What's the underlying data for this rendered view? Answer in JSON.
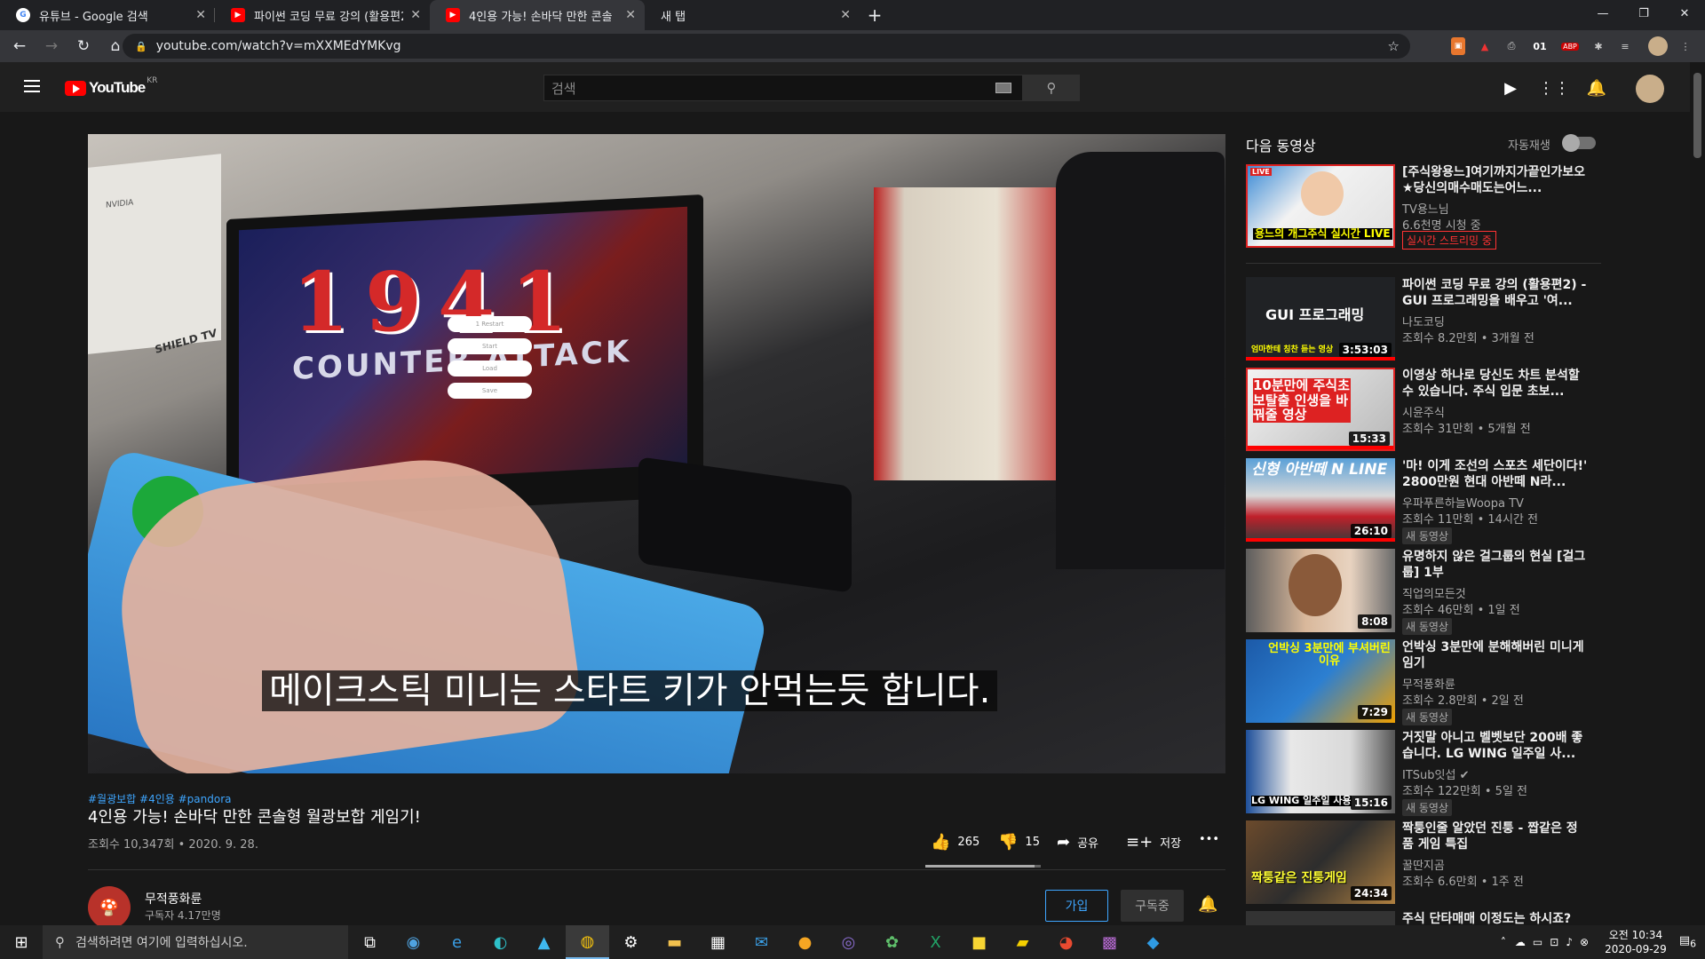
{
  "browser": {
    "tabs": [
      {
        "title": "유튜브 - Google 검색",
        "favicon": "google-icon",
        "active": false
      },
      {
        "title": "파이썬 코딩 무료 강의 (활용편2) -",
        "favicon": "youtube-icon",
        "active": false
      },
      {
        "title": "4인용 가능! 손바닥 만한 콘솔",
        "favicon": "youtube-icon",
        "active": true
      },
      {
        "title": "새 탭",
        "favicon": "",
        "active": false
      }
    ],
    "url": "youtube.com/watch?v=mXXMEdYMKvg",
    "extensions": [
      "ext-orange-icon",
      "pdf-icon",
      "printer-icon",
      "01",
      "adblock-icon",
      "puzzle-icon",
      "playlist-icon",
      "profile-icon"
    ],
    "adblock_count": "25"
  },
  "youtube": {
    "logo_text": "YouTube",
    "region": "KR",
    "search_placeholder": "검색"
  },
  "video": {
    "game_title": "1941",
    "subtitle_line": "COUNTER ATTACK",
    "menu_items": [
      "1 Restart",
      "Start",
      "Load",
      "Save"
    ],
    "caption": "메이크스틱 미니는 스타트 키가 안먹는듯 합니다.",
    "box_label": "SHIELD TV",
    "box_brand": "NVIDIA",
    "tags": "#월광보합 #4인용 #pandora",
    "title": "4인용 가능! 손바닥 만한 콘솔형 월광보합 게임기!",
    "views": "조회수 10,347회 • 2020. 9. 28.",
    "likes": "265",
    "dislikes": "15",
    "like_ratio": 0.946,
    "share": "공유",
    "save": "저장",
    "more": "•••"
  },
  "channel": {
    "name": "무적풍화륜",
    "subscribers": "구독자 4.17만명",
    "join": "가입",
    "subscribed": "구독중"
  },
  "sidebar": {
    "up_next": "다음 동영상",
    "autoplay": "자동재생",
    "live": {
      "title": "[주식왕용느]여기까지가끝인가보오★당신의매수매도는어느...",
      "channel": "TV용느님",
      "stat": "6.6천명 시청 중",
      "badge": "실시간 스트리밍 중",
      "thumb_text": "용느의 개그주식 실시간 LIVE",
      "thumb_tag": "LIVE"
    },
    "items": [
      {
        "title": "파이썬 코딩 무료 강의 (활용편2) - GUI 프로그래밍을 배우고 '여...",
        "channel": "나도코딩",
        "stat": "조회수 8.2만회 • 3개월 전",
        "duration": "3:53:03",
        "thumb_text": "GUI 프로그래밍",
        "thumb_sub": "엄마한테 칭찬 듣는 영상",
        "badge": "",
        "progress": 1.0
      },
      {
        "title": "이영상 하나로 당신도 차트 분석할 수 있습니다. 주식 입문 초보...",
        "channel": "시윤주식",
        "stat": "조회수 31만회 • 5개월 전",
        "duration": "15:33",
        "thumb_text": "10분만에 주식초보탈출 인생을 바꿔줄 영상",
        "thumb_sub": "",
        "badge": "",
        "progress": 1.0
      },
      {
        "title": "'마! 이게 조선의 스포츠 세단이다!' 2800만원 현대 아반떼 N라...",
        "channel": "우파푸른하늘Woopa TV",
        "stat": "조회수 11만회 • 14시간 전",
        "duration": "26:10",
        "thumb_text": "신형 아반떼 N LINE",
        "thumb_sub": "",
        "badge": "새 동영상",
        "progress": 1.0
      },
      {
        "title": "유명하지 않은 걸그룹의 현실 [걸그룹] 1부",
        "channel": "직업의모든것",
        "stat": "조회수 46만회 • 1일 전",
        "duration": "8:08",
        "thumb_text": "",
        "thumb_sub": "",
        "badge": "새 동영상",
        "progress": 0
      },
      {
        "title": "언박싱 3분만에 분해해버린 미니게임기",
        "channel": "무적풍화륜",
        "stat": "조회수 2.8만회 • 2일 전",
        "duration": "7:29",
        "thumb_text": "언박싱 3분만에 부셔버린 이유",
        "thumb_sub": "",
        "badge": "새 동영상",
        "progress": 0
      },
      {
        "title": "거짓말 아니고 벨벳보단 200배 좋습니다. LG WING 일주일 사...",
        "channel": "ITSub잇섭",
        "stat": "조회수 122만회 • 5일 전",
        "duration": "15:16",
        "thumb_text": "LG WING 일주일 사용",
        "thumb_sub": "",
        "badge": "새 동영상",
        "progress": 0
      },
      {
        "title": "짝퉁인줄 알았던 진퉁 - 짭같은 정품 게임 특집",
        "channel": "꿀딴지곰",
        "stat": "조회수 6.6만회 • 1주 전",
        "duration": "24:34",
        "thumb_text": "짝퉁같은 진퉁게임",
        "thumb_sub": "",
        "badge": "",
        "progress": 0
      },
      {
        "title": "주식 단타매매 이정도는 하시죠?",
        "channel": "",
        "stat": "",
        "duration": "",
        "thumb_text": "",
        "thumb_sub": "",
        "badge": "",
        "progress": 0
      }
    ]
  },
  "taskbar": {
    "search_placeholder": "검색하려면 여기에 입력하십시오.",
    "time": "오전 10:34",
    "date": "2020-09-29",
    "notif_count": "6"
  },
  "colors": {
    "accent": "#3ea6ff",
    "yt_red": "#ff0000",
    "bg": "#181818"
  }
}
